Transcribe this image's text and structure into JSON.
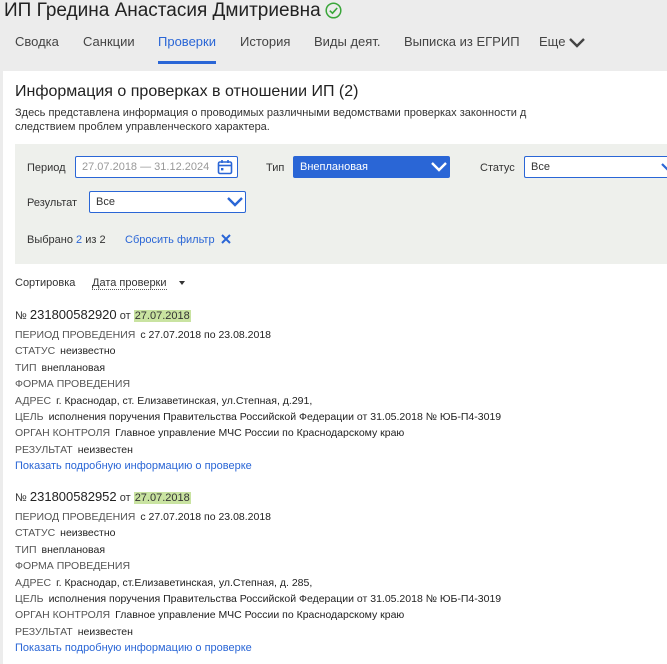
{
  "header": {
    "company_name": "ИП Гредина Анастасия Дмитриевна",
    "status_icon": "check-circle-icon"
  },
  "tabs": [
    {
      "label": "Сводка"
    },
    {
      "label": "Санкции"
    },
    {
      "label": "Проверки",
      "active": true
    },
    {
      "label": "История"
    },
    {
      "label": "Виды деят."
    },
    {
      "label": "Выписка из ЕГРИП"
    },
    {
      "label": "Еще"
    }
  ],
  "section": {
    "title": "Информация о проверках в отношении ИП (2)",
    "description_line1": "Здесь представлена информация о проводимых различными ведомствами проверках законности д",
    "description_line2": "следствием проблем управленческого характера."
  },
  "filters": {
    "period_label": "Период",
    "period_value": "27.07.2018 — 31.12.2024",
    "type_label": "Тип",
    "type_value": "Внеплановая",
    "status_label": "Статус",
    "status_value": "Все",
    "result_label": "Результат",
    "result_value": "Все",
    "selected_prefix": "Выбрано",
    "selected_count": "2",
    "selected_suffix": "из 2",
    "reset_label": "Сбросить фильтр"
  },
  "sort": {
    "label": "Сортировка",
    "value": "Дата проверки"
  },
  "inspections": [
    {
      "no_prefix": "№",
      "number": "231800582920",
      "from": "от",
      "date": "27.07.2018",
      "period_key": "Период проведения",
      "period": "с 27.07.2018 по 23.08.2018",
      "status_key": "Статус",
      "status": "неизвестно",
      "type_key": "Тип",
      "type": "внеплановая",
      "form_key": "Форма проведения",
      "form": "",
      "address_key": "Адрес",
      "address": "г. Краснодар, ст. Елизаветинская, ул.Степная, д.291,",
      "goal_key": "Цель",
      "goal": "исполнения поручения Правительства Российской Федерации от 31.05.2018 № ЮБ-П4-3019",
      "authority_key": "Орган контроля",
      "authority": "Главное управление МЧС России по Краснодарскому краю",
      "result_key": "Результат",
      "result": "неизвестен",
      "more_link": "Показать подробную информацию о проверке"
    },
    {
      "no_prefix": "№",
      "number": "231800582952",
      "from": "от",
      "date": "27.07.2018",
      "period_key": "Период проведения",
      "period": "с 27.07.2018 по 23.08.2018",
      "status_key": "Статус",
      "status": "неизвестно",
      "type_key": "Тип",
      "type": "внеплановая",
      "form_key": "Форма проведения",
      "form": "",
      "address_key": "Адрес",
      "address": "г. Краснодар, ст.Елизаветинская, ул.Степная, д. 285,",
      "goal_key": "Цель",
      "goal": "исполнения поручения Правительства Российской Федерации от 31.05.2018 № ЮБ-П4-3019",
      "authority_key": "Орган контроля",
      "authority": "Главное управление МЧС России по Краснодарскому краю",
      "result_key": "Результат",
      "result": "неизвестен",
      "more_link": "Показать подробную информацию о проверке"
    }
  ],
  "colors": {
    "accent": "#2a66d6",
    "date_highlight": "#c9e3a1",
    "filter_bg": "#eef0ec",
    "ok_green": "#3aa63a"
  }
}
